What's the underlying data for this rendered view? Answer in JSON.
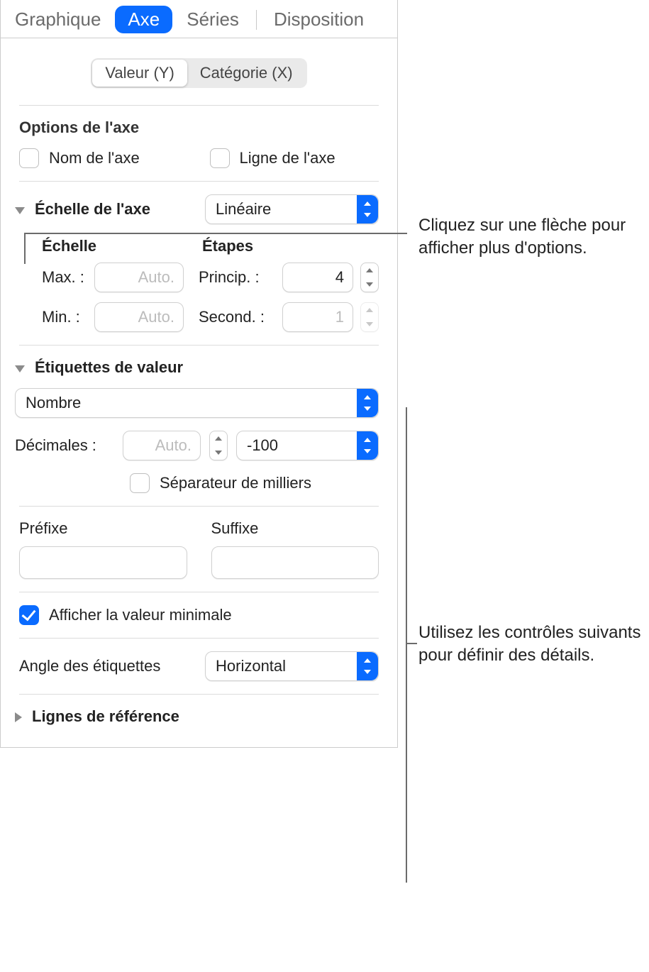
{
  "tabs": {
    "graphique": "Graphique",
    "axe": "Axe",
    "series": "Séries",
    "disposition": "Disposition"
  },
  "segmented": {
    "valueY": "Valeur (Y)",
    "categoryX": "Catégorie (X)"
  },
  "axisOptions": {
    "title": "Options de l'axe",
    "name": "Nom de l'axe",
    "line": "Ligne de l'axe"
  },
  "axisScale": {
    "label": "Échelle de l'axe",
    "type": "Linéaire",
    "scaleHeader": "Échelle",
    "stepsHeader": "Étapes",
    "maxLabel": "Max. :",
    "maxPlaceholder": "Auto.",
    "minLabel": "Min. :",
    "minPlaceholder": "Auto.",
    "primaryLabel": "Princip. :",
    "primaryValue": "4",
    "secondaryLabel": "Second. :",
    "secondaryValue": "1"
  },
  "valueLabels": {
    "title": "Étiquettes de valeur",
    "format": "Nombre",
    "decimalsLabel": "Décimales :",
    "decimalsPlaceholder": "Auto.",
    "negFormat": "-100",
    "thousands": "Séparateur de milliers"
  },
  "prefixSuffix": {
    "prefix": "Préfixe",
    "suffix": "Suffixe"
  },
  "showMin": "Afficher la valeur minimale",
  "angle": {
    "label": "Angle des étiquettes",
    "value": "Horizontal"
  },
  "refLines": "Lignes de référence",
  "callout1": "Cliquez sur une flèche pour afficher plus d'options.",
  "callout2": "Utilisez les contrôles suivants pour définir des détails."
}
